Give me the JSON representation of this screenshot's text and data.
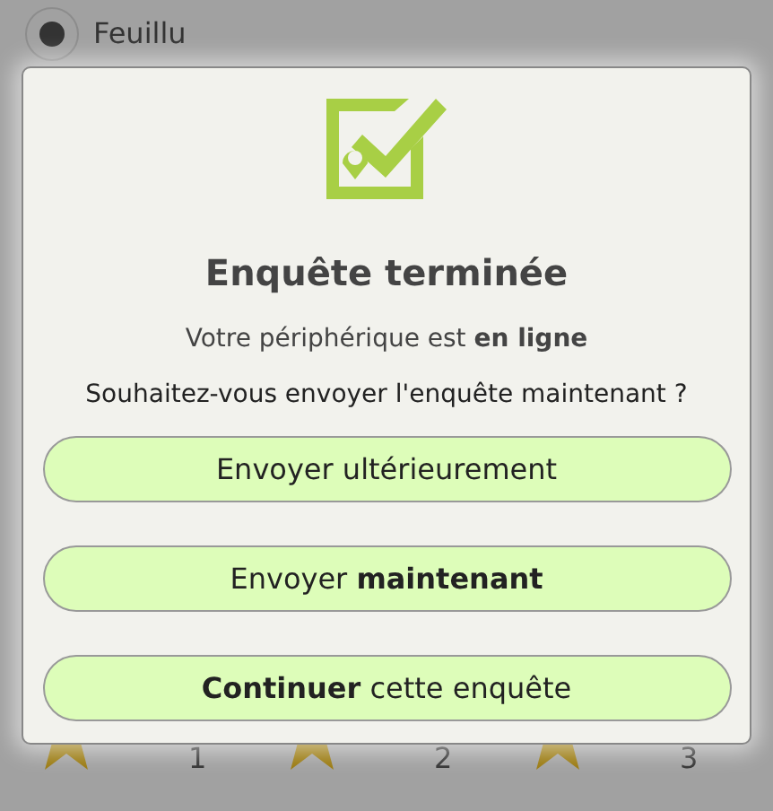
{
  "background_options": [
    {
      "label": "Feuillu",
      "selected": true
    }
  ],
  "dialog": {
    "title": "Enquête terminée",
    "status": "Votre périphérique est **en ligne**",
    "question": "Souhaitez-vous envoyer l'enquête maintenant ?",
    "buttons": [
      {
        "label": "Envoyer ultérieurement"
      },
      {
        "label": "Envoyer **maintenant**"
      },
      {
        "label": "**Continuer** cette enquête"
      }
    ]
  },
  "rating_options": [
    {
      "label": "1"
    },
    {
      "label": "2"
    },
    {
      "label": "3"
    }
  ]
}
